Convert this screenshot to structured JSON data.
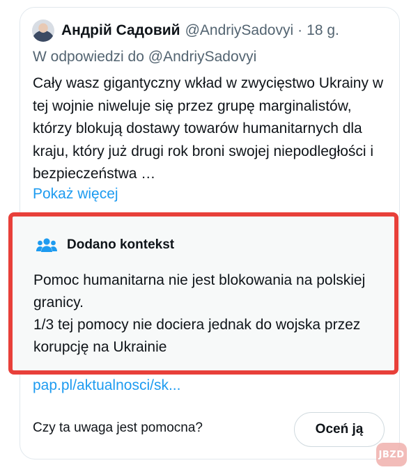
{
  "tweet": {
    "author_name": "Андрій Садовий",
    "author_handle": "@AndriySadovyi",
    "separator": "·",
    "time": "18 g.",
    "reply_to": "W odpowiedzi do @AndriySadovyi",
    "text": "Cały wasz gigantyczny wkład w zwycięstwo Ukrainy w tej wojnie niweluje się przez grupę marginalistów, którzy blokują dostawy towarów humanitarnych dla kraju, który już drugi rok broni swojej niepodległości i bezpieczeństwa …",
    "show_more": "Pokaż więcej"
  },
  "context": {
    "icon": "people-group-icon",
    "title": "Dodano kontekst",
    "line1": "Pomoc humanitarna nie jest blokowania na polskiej granicy.",
    "line2": "1/3 tej pomocy nie dociera jednak do wojska przez korupcję na Ukrainie",
    "highlight_color": "#e8403a"
  },
  "source_link": "pap.pl/aktualnosci/sk...",
  "rating": {
    "question": "Czy ta uwaga jest pomocna?",
    "button_label": "Oceń ją"
  },
  "watermark": "JBZD",
  "colors": {
    "link": "#1d9bf0",
    "muted": "#536471",
    "text": "#0f1419"
  }
}
